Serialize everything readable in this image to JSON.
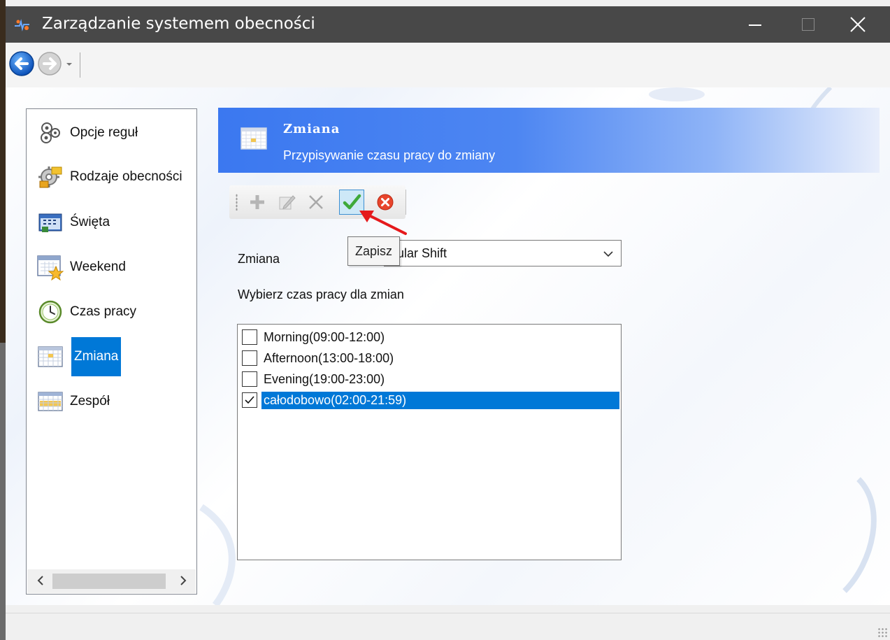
{
  "window": {
    "title": "Zarządzanie systemem obecności",
    "app_icon": "app-logo-icon",
    "controls": [
      "minimize-icon",
      "maximize-icon",
      "close-icon"
    ]
  },
  "nav": {
    "back_icon": "back-arrow-icon",
    "forward_icon": "forward-arrow-icon",
    "history_icon": "dropdown-arrow-icon"
  },
  "sidebar": {
    "items": [
      {
        "label": "Opcje reguł",
        "icon": "rules-options-icon",
        "selected": false
      },
      {
        "label": "Rodzaje obecności",
        "icon": "attendance-types-icon",
        "selected": false
      },
      {
        "label": "Święta",
        "icon": "holidays-icon",
        "selected": false
      },
      {
        "label": "Weekend",
        "icon": "weekend-calendar-star-icon",
        "selected": false
      },
      {
        "label": "Czas pracy",
        "icon": "clock-icon",
        "selected": false
      },
      {
        "label": "Zmiana",
        "icon": "shift-grid-icon",
        "selected": true
      },
      {
        "label": "Zespół",
        "icon": "team-grid-icon",
        "selected": false
      }
    ]
  },
  "header": {
    "title": "Zmiana",
    "subtitle": "Przypisywanie czasu pracy do zmiany",
    "icon": "shift-grid-icon",
    "gradient": [
      "#3b78f0",
      "#e8eefb"
    ]
  },
  "toolbar": {
    "buttons": [
      "add-icon",
      "edit-icon",
      "delete-icon",
      "save-check-icon",
      "cancel-icon"
    ],
    "active": "save-check-icon"
  },
  "tooltip": {
    "text": "Zapisz"
  },
  "form": {
    "shift_label": "Zmiana",
    "shift_value": "gular Shift",
    "work_time_label": "Wybierz czas pracy dla zmian"
  },
  "work_times": [
    {
      "label": "Morning(09:00-12:00)",
      "checked": false,
      "selected": false
    },
    {
      "label": "Afternoon(13:00-18:00)",
      "checked": false,
      "selected": false
    },
    {
      "label": "Evening(19:00-23:00)",
      "checked": false,
      "selected": false
    },
    {
      "label": "całodobowo(02:00-21:59)",
      "checked": true,
      "selected": true
    }
  ],
  "colors": {
    "accent": "#0078d7",
    "titlebar": "#484848",
    "annotation": "#e5191c"
  }
}
